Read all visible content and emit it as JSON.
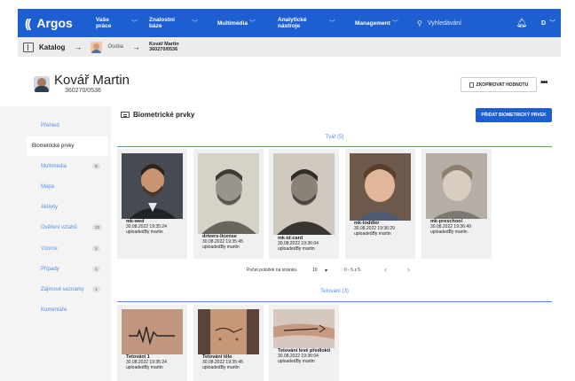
{
  "topbar": {
    "logo_mark": "((",
    "logo_text": "Argos",
    "nav": [
      {
        "label": "Vaše práce"
      },
      {
        "label": "Znalostní báze"
      },
      {
        "label": "Multimédia"
      },
      {
        "label": "Analytické nástroje"
      },
      {
        "label": "Management"
      }
    ],
    "search_placeholder": "Vyhledávání",
    "user_initial": "D"
  },
  "breadcrumb": {
    "catalog": "Katalog",
    "arrow": "→",
    "osoba": "Osoba",
    "name": "Kovář Martin",
    "id": "360270/0536"
  },
  "header": {
    "name": "Kovář Martin",
    "id": "360270/0536",
    "copy_label": "ZKOPÍROVAT HODNOTU",
    "more": "•••"
  },
  "sidebar": {
    "items": [
      {
        "label": "Přehled"
      },
      {
        "label": "Biometrické prvky"
      },
      {
        "label": "Multimédia",
        "count": "5"
      },
      {
        "label": "Mapa"
      },
      {
        "label": "Aktivity"
      },
      {
        "label": "Ověření vztahů",
        "count": "13"
      },
      {
        "label": "Vzorce",
        "count": "1"
      },
      {
        "label": "Případy",
        "count": "1"
      },
      {
        "label": "Zájmové seznamy",
        "count": "1"
      },
      {
        "label": "Komentáře"
      }
    ]
  },
  "main": {
    "title": "Biometrické prvky",
    "add_label": "PŘIDAT BIOMETRICKÝ PRVEK",
    "face_group": "Tvář (5)",
    "faces": [
      {
        "name": "mk-wed",
        "date": "30.08.2022 19:35:24",
        "by": "uploadedBy martin"
      },
      {
        "name": "drivers-license",
        "date": "30.08.2022 19:35:45",
        "by": "uploadedBy martin"
      },
      {
        "name": "mk-id-card",
        "date": "30.08.2022 19:36:04",
        "by": "uploadedBy martin"
      },
      {
        "name": "mk-toddler",
        "date": "30.08.2022 19:36:29",
        "by": "uploadedBy martin"
      },
      {
        "name": "mk-preschool",
        "date": "30.08.2022 19:36:49",
        "by": "uploadedBy martin"
      }
    ],
    "pager": {
      "per_page_label": "Počet položek na stránku",
      "per_page_value": "10",
      "range": "0 - 5 z 5",
      "prev": "‹",
      "next": "›"
    },
    "tattoo_group": "Tetování (3)",
    "tattoos": [
      {
        "name": "Tetování 1",
        "date": "30.08.2022 19:35:24",
        "by": "uploadedBy martin"
      },
      {
        "name": "Tetování tělo",
        "date": "30.08.2022 19:35:45",
        "by": "uploadedBy martin"
      },
      {
        "name": "Tetování levé předloktí",
        "date": "30.08.2022 19:36:04",
        "by": "uploadedBy martin"
      }
    ]
  },
  "colors": {
    "brand": "#1d5fd1",
    "link": "#4f8fea",
    "card_bg": "#f0f0f0"
  }
}
